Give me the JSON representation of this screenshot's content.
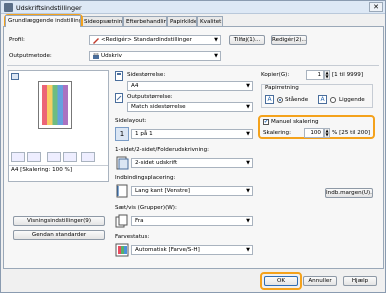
{
  "window": {
    "title": "Udskriftsindstillinger",
    "close_glyph": "✕"
  },
  "tabs": [
    "Grundlæggende indstillinger",
    "Sideopsætning",
    "Efterbehandling",
    "Papirkilde",
    "Kvalitet"
  ],
  "profile": {
    "label": "Profil:",
    "value": "<Redigér> Standardindstillinger",
    "add_button": "Tilføj(1)...",
    "edit_button": "Redigér(2)..."
  },
  "output": {
    "label": "Outputmetode:",
    "value": "Udskriv"
  },
  "preview": {
    "caption": "A4 [Skalering: 100 %]",
    "settings_button": "Visningsindstillinger(9)",
    "restore_button": "Gendan standarder"
  },
  "page_size": {
    "label": "Sidestørrelse:",
    "value": "A4"
  },
  "output_size": {
    "label": "Outputstørrelse:",
    "value": "Match sidestørrelse"
  },
  "copies": {
    "label": "Kopier(G):",
    "value": "1",
    "range": "[1 til 9999]"
  },
  "orientation": {
    "label": "Papirretning",
    "portrait": "Stående",
    "landscape": "Liggende"
  },
  "layout": {
    "label": "Sidelayout:",
    "value": "1 på 1"
  },
  "manual_scaling": {
    "label": "Manuel skalering",
    "checked": true
  },
  "scaling": {
    "label": "Skalering:",
    "value": "100",
    "range": "% [25 til 200]"
  },
  "duplex": {
    "label": "1-sidet/2-sidet/Folderudskrivning:",
    "value": "2-sidet udskrift"
  },
  "binding": {
    "label": "Indbindingsplacering:",
    "value": "Lang kant [Venstre]",
    "margin_button": "Indb.margen(U)..."
  },
  "collate": {
    "label": "Sæt/vis (Grupper)(W):",
    "value": "Fra"
  },
  "color": {
    "label": "Farvestatus:",
    "value": "Automatisk [Farve/S-H]"
  },
  "footer": {
    "ok": "OK",
    "cancel": "Annuller",
    "help": "Hjælp"
  },
  "colors": {
    "highlight": "#f4a21c",
    "accent": "#2f6db5"
  }
}
